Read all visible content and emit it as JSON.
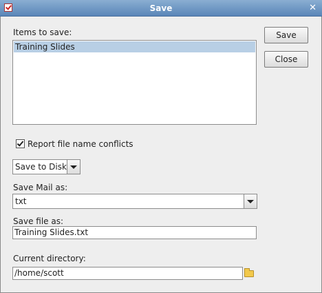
{
  "window": {
    "title": "Save"
  },
  "items": {
    "label": "Items to save:",
    "list": [
      "Training Slides"
    ]
  },
  "buttons": {
    "save": "Save",
    "close": "Close"
  },
  "options": {
    "report_conflicts_label": "Report file name conflicts",
    "report_conflicts_checked": true
  },
  "destination": {
    "selected": "Save to Disk"
  },
  "mail_format": {
    "label": "Save Mail as:",
    "selected": "txt"
  },
  "file": {
    "label": "Save file as:",
    "value": "Training Slides.txt"
  },
  "directory": {
    "label": "Current directory:",
    "value": "/home/scott"
  },
  "icons": {
    "app": "checkmark-app-icon",
    "close": "close-icon",
    "browse": "folder-icon",
    "dropdown": "chevron-down-icon"
  }
}
